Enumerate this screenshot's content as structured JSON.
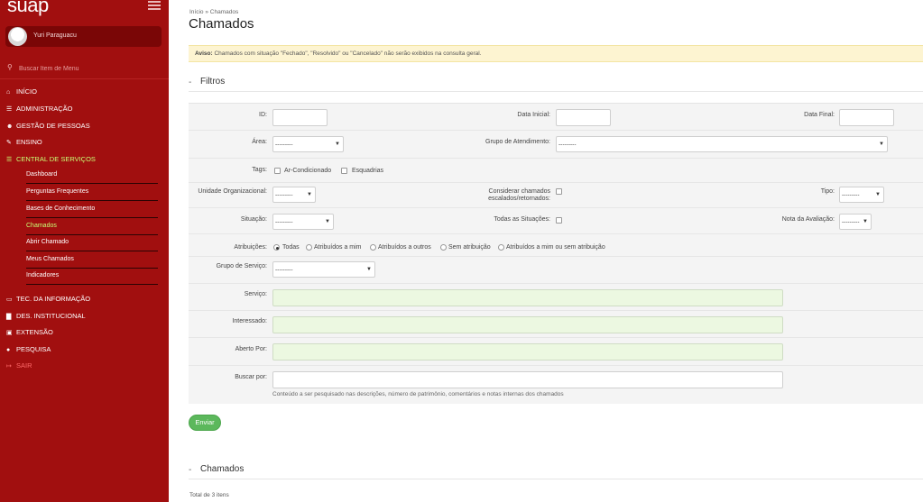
{
  "sidebar": {
    "logo": "suap",
    "user_name": "Yuri Paraguacu",
    "search_placeholder": "Buscar Item de Menu",
    "items": [
      {
        "icon": "home-icon",
        "glyph": "⌂",
        "label": "Início",
        "active": false
      },
      {
        "icon": "list-icon",
        "glyph": "☰",
        "label": "Administração",
        "active": false
      },
      {
        "icon": "users-icon",
        "glyph": "☺",
        "label": "Gestão de Pessoas",
        "active": false
      },
      {
        "icon": "pencil-icon",
        "glyph": "✎",
        "label": "Ensino",
        "active": false
      },
      {
        "icon": "list-icon",
        "glyph": "☰",
        "label": "Central de Serviços",
        "active": true
      }
    ],
    "sub_items": [
      {
        "label": "Dashboard",
        "active": false
      },
      {
        "label": "Perguntas Frequentes",
        "active": false
      },
      {
        "label": "Bases de Conhecimento",
        "active": false
      },
      {
        "label": "Chamados",
        "active": true
      },
      {
        "label": "Abrir Chamado",
        "active": false
      },
      {
        "label": "Meus Chamados",
        "active": false
      },
      {
        "label": "Indicadores",
        "active": false
      }
    ],
    "items2": [
      {
        "icon": "laptop-icon",
        "glyph": "▭",
        "label": "Tec. da Informação"
      },
      {
        "icon": "chart-icon",
        "glyph": "▇",
        "label": "Des. Institucional"
      },
      {
        "icon": "briefcase-icon",
        "glyph": "▣",
        "label": "Extensão"
      },
      {
        "icon": "globe-icon",
        "glyph": "●",
        "label": "Pesquisa"
      },
      {
        "icon": "logout-icon",
        "glyph": "↦",
        "label": "Sair"
      }
    ]
  },
  "breadcrumb": {
    "home": "Início",
    "sep": "»",
    "current": "Chamados"
  },
  "page_title": "Chamados",
  "notice": {
    "bold": "Aviso:",
    "text": "Chamados com situação \"Fechado\", \"Resolvido\" ou \"Cancelado\" não serão exibidos na consulta geral."
  },
  "filters_section": {
    "dash": "-",
    "title": "Filtros"
  },
  "filters": {
    "id_label": "ID:",
    "data_inicial_label": "Data Inicial:",
    "data_final_label": "Data Final:",
    "area_label": "Área:",
    "area_value": "---------",
    "grupo_atendimento_label": "Grupo de Atendimento:",
    "grupo_atendimento_value": "---------",
    "tags_label": "Tags:",
    "tags": [
      "Ar-Condicionado",
      "Esquadrias"
    ],
    "unidade_label": "Unidade Organizacional:",
    "unidade_value": "---------",
    "considerar_label_1": "Considerar chamados",
    "considerar_label_2": "escalados/retornados:",
    "tipo_label": "Tipo:",
    "tipo_value": "---------",
    "situacao_label": "Situação:",
    "situacao_value": "---------",
    "todas_situacoes_label": "Todas as Situações:",
    "nota_label": "Nota da Avaliação:",
    "nota_value": "---------",
    "atribuicoes_label": "Atribuições:",
    "atribuicoes": [
      {
        "label": "Todas",
        "selected": true
      },
      {
        "label": "Atribuídos a mim",
        "selected": false
      },
      {
        "label": "Atribuídos a outros",
        "selected": false
      },
      {
        "label": "Sem atribuição",
        "selected": false
      },
      {
        "label": "Atribuídos a mim ou sem atribuição",
        "selected": false
      }
    ],
    "grupo_servico_label": "Grupo de Serviço:",
    "grupo_servico_value": "---------",
    "servico_label": "Serviço:",
    "interessado_label": "Interessado:",
    "aberto_por_label": "Aberto Por:",
    "buscar_label": "Buscar por:",
    "buscar_help": "Conteúdo a ser pesquisado nas descrições, número de patrimônio, comentários e notas internas dos chamados"
  },
  "send_label": "Enviar",
  "results_section": {
    "dash": "-",
    "title": "Chamados"
  },
  "total_text": "Total de 3 itens",
  "colors": {
    "sidebar_bg": "#a10f0f",
    "active_menu": "#c9ff74",
    "notice_bg": "#fdf4d1",
    "button": "#5cb85c",
    "autocomplete_bg": "#ecf8e1"
  }
}
